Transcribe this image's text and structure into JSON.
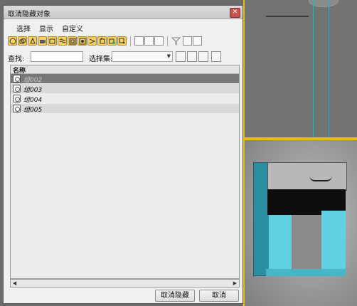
{
  "dialog": {
    "title": "取消隐藏对象",
    "close_glyph": "✕"
  },
  "menu": {
    "items": [
      "选择",
      "显示",
      "自定义"
    ]
  },
  "find": {
    "label": "查找:",
    "value": ""
  },
  "selection_set": {
    "label": "选择集:",
    "value": ""
  },
  "list": {
    "header": "名称",
    "rows": [
      "组002",
      "组003",
      "组004",
      "组005"
    ],
    "selected_index": 0
  },
  "buttons": {
    "unhide": "取消隐藏",
    "cancel": "取消"
  },
  "colors": {
    "toolbar_accent": "#f4d060",
    "viewport_border": "#e5c100",
    "selected_row": "#777777"
  }
}
